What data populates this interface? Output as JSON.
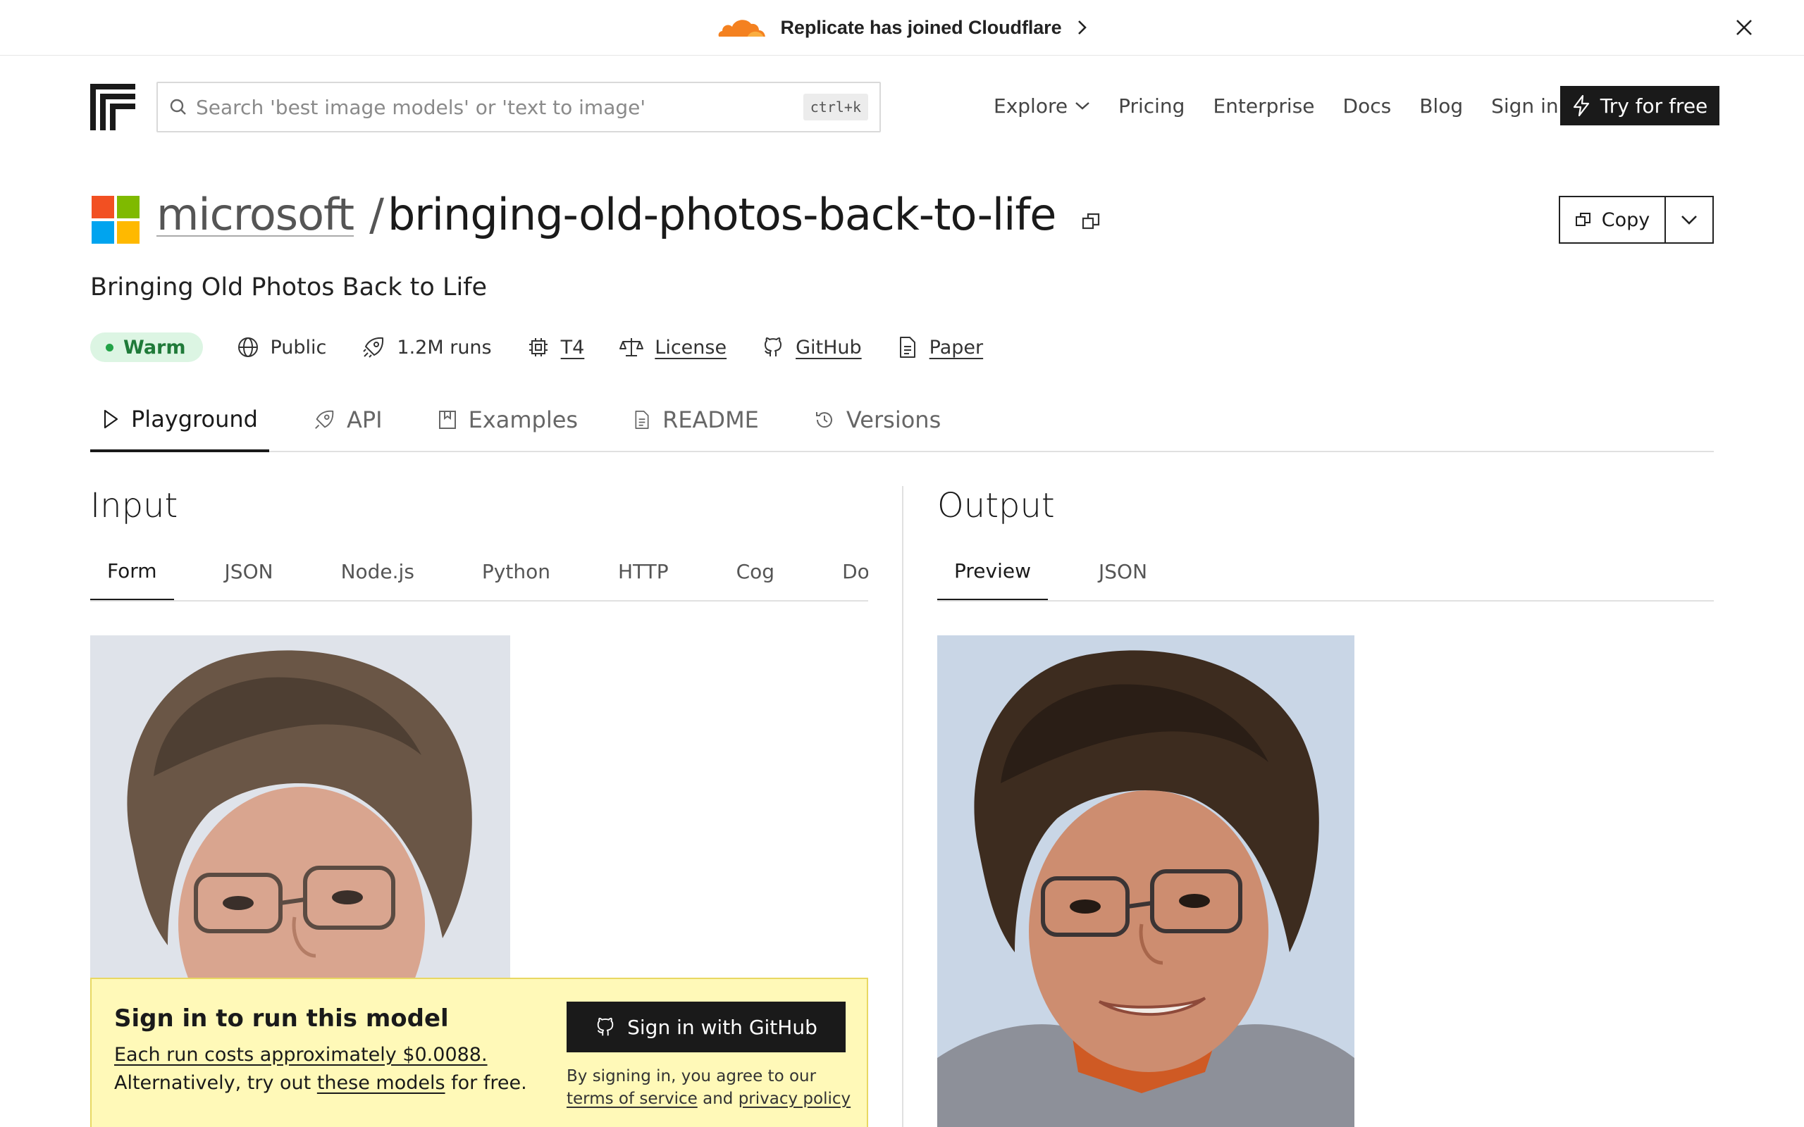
{
  "banner": {
    "text": "Replicate has joined Cloudflare",
    "accent_color": "#f48120"
  },
  "nav": {
    "search_placeholder": "Search 'best image models' or 'text to image'",
    "search_shortcut": "ctrl+k",
    "links": [
      "Explore",
      "Pricing",
      "Enterprise",
      "Docs",
      "Blog",
      "Sign in"
    ],
    "cta": "Try for free"
  },
  "model": {
    "owner": "microsoft",
    "separator": "/",
    "name": "bringing-old-photos-back-to-life",
    "description": "Bringing Old Photos Back to Life",
    "copy_label": "Copy",
    "logo_colors": [
      "#f25022",
      "#7fba00",
      "#00a4ef",
      "#ffb900"
    ]
  },
  "meta": {
    "status": "Warm",
    "status_color": "#22a347",
    "visibility": "Public",
    "runs": "1.2M runs",
    "hardware": "T4",
    "license": "License",
    "github": "GitHub",
    "paper": "Paper"
  },
  "tabs": [
    "Playground",
    "API",
    "Examples",
    "README",
    "Versions"
  ],
  "input": {
    "title": "Input",
    "tabs": [
      "Form",
      "JSON",
      "Node.js",
      "Python",
      "HTTP",
      "Cog",
      "Doc"
    ]
  },
  "output": {
    "title": "Output",
    "tabs": [
      "Preview",
      "JSON"
    ]
  },
  "signin": {
    "title": "Sign in to run this model",
    "cost": "Each run costs approximately $0.0088.",
    "alt_prefix": "Alternatively, try out",
    "alt_link": "these models",
    "alt_suffix": "for free.",
    "button": "Sign in with GitHub",
    "legal_prefix": "By signing in, you agree to our",
    "terms": "terms of service",
    "and": "and",
    "privacy": "privacy policy"
  }
}
